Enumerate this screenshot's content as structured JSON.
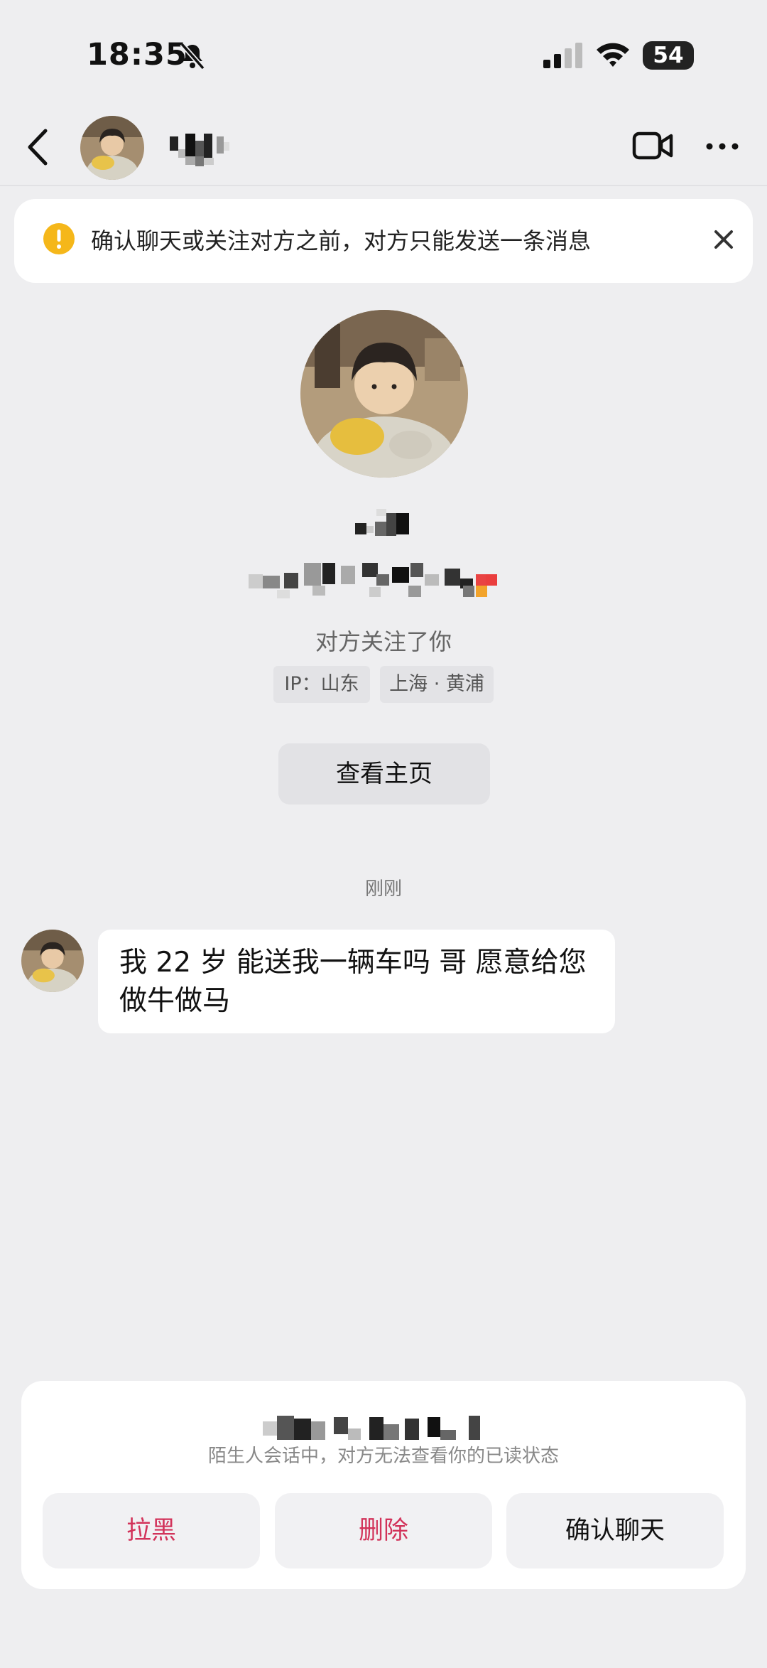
{
  "status_bar": {
    "time": "18:35",
    "battery": "54"
  },
  "icons": {
    "back": "chevron-left-icon",
    "mute": "bell-slash-icon",
    "signal": "cellular-signal-icon",
    "wifi": "wifi-icon",
    "video": "video-camera-icon",
    "more": "ellipsis-icon",
    "warning": "exclamation-circle-icon",
    "close": "close-icon"
  },
  "notice": {
    "text": "确认聊天或关注对方之前，对方只能发送一条消息"
  },
  "profile": {
    "follow_status": "对方关注了你",
    "ip_tag": "IP：山东",
    "location_tag": "上海 · 黄浦",
    "homepage_button": "查看主页"
  },
  "chat": {
    "time": "刚刚",
    "message": "我 22 岁 能送我一辆车吗 哥 愿意给您做牛做马"
  },
  "bottom": {
    "read_notice": "陌生人会话中，对方无法查看你的已读状态",
    "block": "拉黑",
    "delete": "删除",
    "confirm": "确认聊天"
  },
  "colors": {
    "background": "#eeeef0",
    "danger": "#d2335a",
    "warning": "#f5b71a"
  }
}
